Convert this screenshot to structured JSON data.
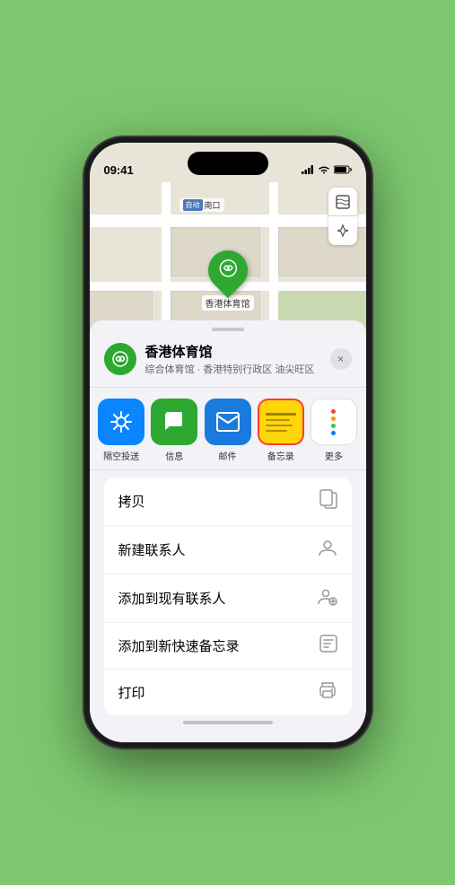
{
  "status_bar": {
    "time": "09:41",
    "signal_icon": "▲",
    "wifi_icon": "wifi",
    "battery_icon": "battery"
  },
  "map": {
    "label_box": "自动",
    "label_text": "南口",
    "location_name": "香港体育馆",
    "controls": {
      "map_type_icon": "🗺",
      "location_icon": "➤"
    }
  },
  "venue": {
    "name": "香港体育馆",
    "subtitle": "综合体育馆 · 香港特别行政区 油尖旺区",
    "close_label": "×"
  },
  "share_apps": [
    {
      "id": "airdrop",
      "label": "隔空投送",
      "icon": "📡"
    },
    {
      "id": "message",
      "label": "信息",
      "icon": "💬"
    },
    {
      "id": "mail",
      "label": "邮件",
      "icon": "✉"
    },
    {
      "id": "notes",
      "label": "备忘录",
      "icon": "notes"
    },
    {
      "id": "more",
      "label": "更多",
      "icon": "⋯"
    }
  ],
  "actions": [
    {
      "id": "copy",
      "label": "拷贝",
      "icon": "copy"
    },
    {
      "id": "new-contact",
      "label": "新建联系人",
      "icon": "person"
    },
    {
      "id": "add-contact",
      "label": "添加到现有联系人",
      "icon": "person-add"
    },
    {
      "id": "quick-note",
      "label": "添加到新快速备忘录",
      "icon": "note"
    },
    {
      "id": "print",
      "label": "打印",
      "icon": "print"
    }
  ]
}
